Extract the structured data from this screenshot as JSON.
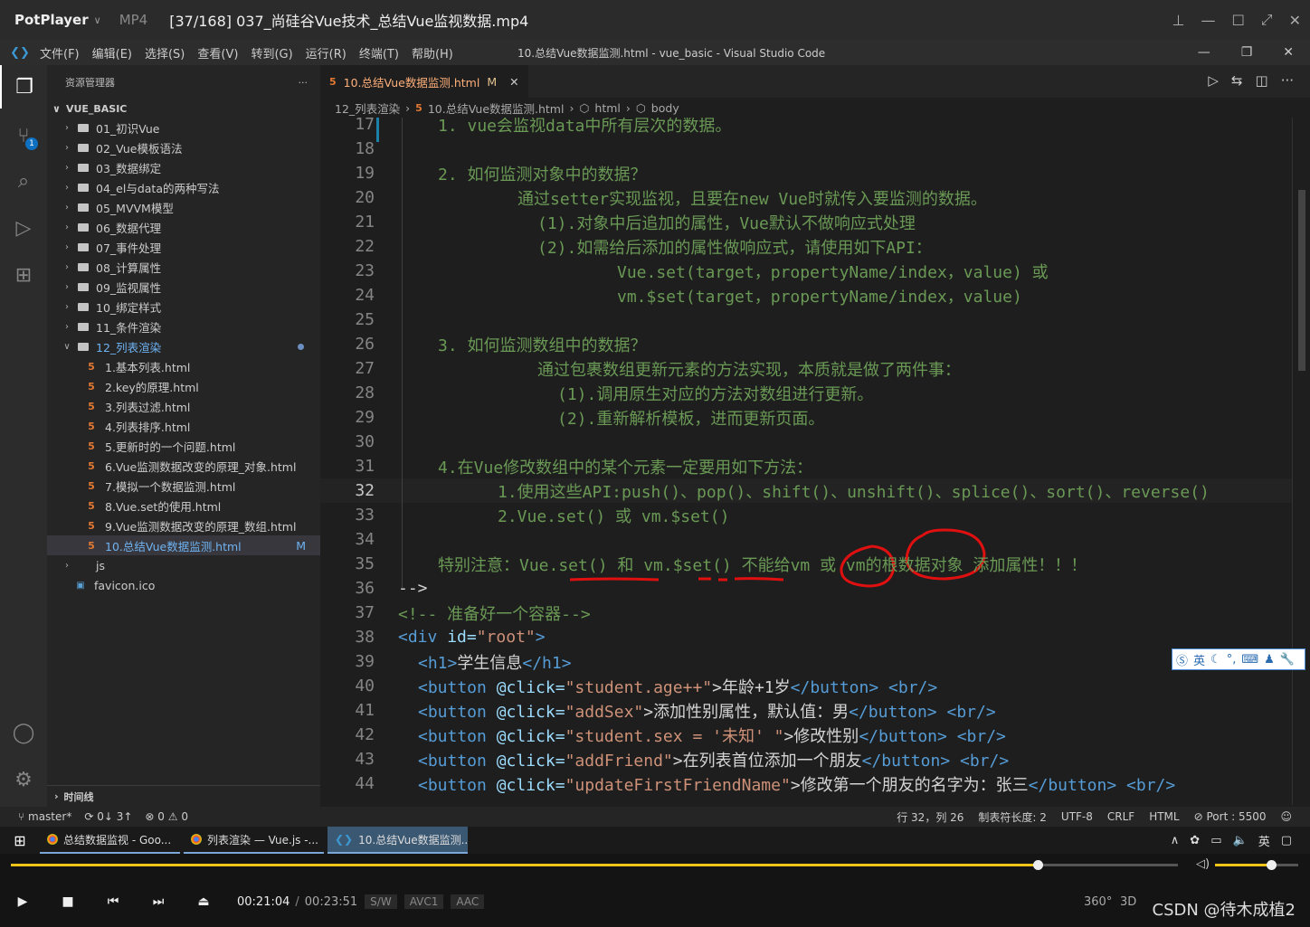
{
  "player": {
    "app_name": "PotPlayer",
    "format": "MP4",
    "file_title": "[37/168] 037_尚硅谷Vue技术_总结Vue监视数据.mp4",
    "time_current": "00:21:04",
    "time_separator": "/",
    "time_total": "00:23:51",
    "badges": [
      "S/W",
      "AVC1",
      "AAC"
    ],
    "progress": 0.88,
    "volume": 0.67,
    "extra_buttons": [
      "360°",
      "3D"
    ],
    "watermark": "CSDN @待木成植2"
  },
  "vscode": {
    "menu": [
      "文件(F)",
      "编辑(E)",
      "选择(S)",
      "查看(V)",
      "转到(G)",
      "运行(R)",
      "终端(T)",
      "帮助(H)"
    ],
    "window_title": "10.总结Vue数据监测.html - vue_basic - Visual Studio Code",
    "explorer_title": "资源管理器",
    "root_folder": "VUE_BASIC",
    "folders_collapsed": [
      "01_初识Vue",
      "02_Vue模板语法",
      "03_数据绑定",
      "04_el与data的两种写法",
      "05_MVVM模型",
      "06_数据代理",
      "07_事件处理",
      "08_计算属性",
      "09_监视属性",
      "10_绑定样式",
      "11_条件渲染"
    ],
    "open_folder": "12_列表渲染",
    "files": [
      "1.基本列表.html",
      "2.key的原理.html",
      "3.列表过滤.html",
      "4.列表排序.html",
      "5.更新时的一个问题.html",
      "6.Vue监测数据改变的原理_对象.html",
      "7.模拟一个数据监测.html",
      "8.Vue.set的使用.html",
      "9.Vue监测数据改变的原理_数组.html",
      "10.总结Vue数据监测.html"
    ],
    "active_file_marker": "M",
    "other_items": [
      "js",
      "favicon.ico"
    ],
    "timeline_label": "时间线",
    "scm_badge": "1",
    "tab_label": "10.总结Vue数据监测.html",
    "tab_marker": "M",
    "breadcrumb": [
      "12_列表渲染",
      "10.总结Vue数据监测.html",
      "html",
      "body"
    ],
    "status": {
      "branch": "master*",
      "sync": "0↓ 3↑",
      "problems": "⊗ 0 ⚠ 0",
      "position": "行 32，列 26",
      "tab_size": "制表符长度: 2",
      "encoding": "UTF-8",
      "eol": "CRLF",
      "language": "HTML",
      "port": "Port : 5500"
    }
  },
  "code_lines": [
    {
      "n": "17",
      "text": "1. vue会监视data中所有层次的数据。"
    },
    {
      "n": "18",
      "text": ""
    },
    {
      "n": "19",
      "text": "2. 如何监测对象中的数据？"
    },
    {
      "n": "20",
      "text": "通过setter实现监视，且要在new Vue时就传入要监测的数据。"
    },
    {
      "n": "21",
      "text": "(1).对象中后追加的属性，Vue默认不做响应式处理"
    },
    {
      "n": "22",
      "text": "(2).如需给后添加的属性做响应式，请使用如下API："
    },
    {
      "n": "23",
      "text": "Vue.set(target，propertyName/index，value) 或"
    },
    {
      "n": "24",
      "text": "vm.$set(target，propertyName/index，value)"
    },
    {
      "n": "25",
      "text": ""
    },
    {
      "n": "26",
      "text": "3. 如何监测数组中的数据？"
    },
    {
      "n": "27",
      "text": "通过包裹数组更新元素的方法实现，本质就是做了两件事："
    },
    {
      "n": "28",
      "text": "(1).调用原生对应的方法对数组进行更新。"
    },
    {
      "n": "29",
      "text": "(2).重新解析模板，进而更新页面。"
    },
    {
      "n": "30",
      "text": ""
    },
    {
      "n": "31",
      "text": "4.在Vue修改数组中的某个元素一定要用如下方法："
    },
    {
      "n": "32",
      "text": "1.使用这些API:push()、pop()、shift()、unshift()、splice()、sort()、reverse()"
    },
    {
      "n": "33",
      "text": "2.Vue.set() 或 vm.$set()"
    },
    {
      "n": "34",
      "text": ""
    },
    {
      "n": "35",
      "text": "特别注意：Vue.set() 和 vm.$set() 不能给vm 或 vm的根数据对象 添加属性！！！"
    },
    {
      "n": "36",
      "text": "-->"
    },
    {
      "n": "37",
      "text": "<!-- 准备好一个容器-->"
    },
    {
      "n": "38",
      "tag_open": "<div",
      "attr": " id=",
      "val": "\"root\"",
      "tag_close": ">"
    },
    {
      "n": "39",
      "tag_open": "<h1>",
      "inner": "学生信息",
      "tag_close": "</h1>"
    },
    {
      "n": "40",
      "tag_open": "<button",
      "attr": " @click=",
      "val": "\"student.age++\"",
      "inner": ">年龄+1岁",
      "tag_close": "</button>",
      "br": " <br/>"
    },
    {
      "n": "41",
      "tag_open": "<button",
      "attr": " @click=",
      "val": "\"addSex\"",
      "inner": ">添加性别属性，默认值：男",
      "tag_close": "</button>",
      "br": " <br/>"
    },
    {
      "n": "42",
      "tag_open": "<button",
      "attr": " @click=",
      "val": "\"student.sex = '未知' \"",
      "inner": ">修改性别",
      "tag_close": "</button>",
      "br": " <br/>"
    },
    {
      "n": "43",
      "tag_open": "<button",
      "attr": " @click=",
      "val": "\"addFriend\"",
      "inner": ">在列表首位添加一个朋友",
      "tag_close": "</button>",
      "br": " <br/>"
    },
    {
      "n": "44",
      "tag_open": "<button",
      "attr": " @click=",
      "val": "\"updateFirstFriendName\"",
      "inner": ">修改第一个朋友的名字为：张三",
      "tag_close": "</button>",
      "br": " <br/>"
    }
  ],
  "ime_label": "英",
  "taskbar": {
    "tasks": [
      "总结数据监视 - Goo...",
      "列表渲染 — Vue.js -...",
      "10.总结Vue数据监测...."
    ],
    "tray_lang": "英"
  },
  "colors": {
    "accent": "#0e70c0",
    "seek": "#f0c419",
    "annotation": "#e01010"
  }
}
